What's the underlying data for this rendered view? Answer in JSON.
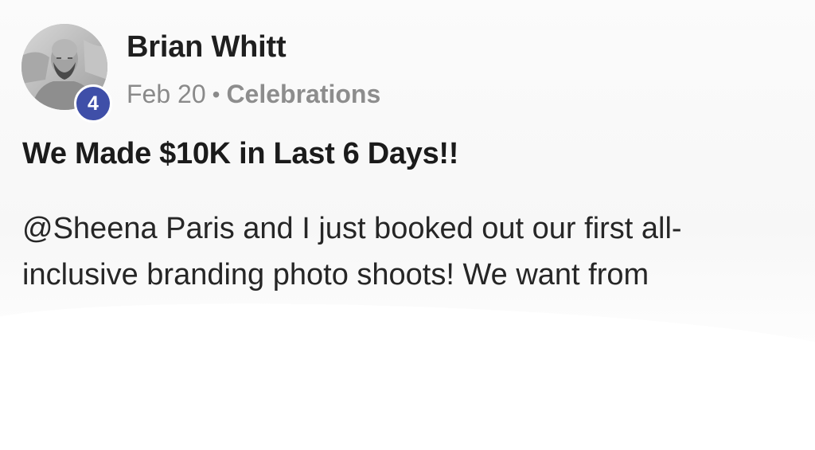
{
  "post": {
    "author": {
      "name": "Brian Whitt",
      "level": "4"
    },
    "meta": {
      "date": "Feb 20",
      "separator": "•",
      "category": "Celebrations"
    },
    "title": "We Made $10K in Last 6 Days!!",
    "body": {
      "mention": "@Sheena Paris",
      "text_line1": " and I just booked out our first all-",
      "text_line2": "inclusive branding photo shoots! We want from"
    }
  },
  "colors": {
    "badge": "#3f4fa8",
    "meta_text": "#8a8a8a",
    "title_text": "#1b1b1b"
  },
  "icons": {
    "avatar": "user-photo-avatar"
  }
}
